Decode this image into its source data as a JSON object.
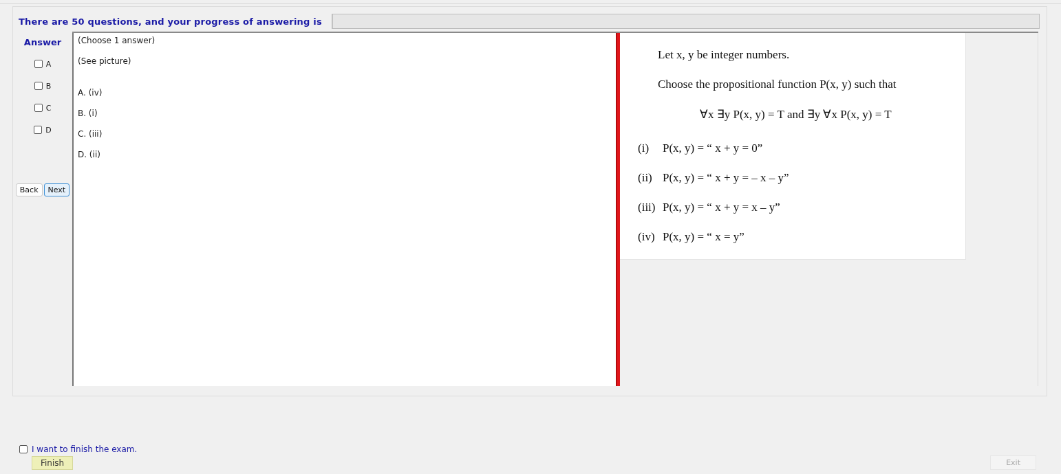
{
  "header": {
    "text": "There are 50 questions, and your progress of answering is",
    "progress": {
      "level": 0
    }
  },
  "answer": {
    "title": "Answer",
    "options": [
      {
        "label": "A",
        "checked": false
      },
      {
        "label": "B",
        "checked": false
      },
      {
        "label": "C",
        "checked": false
      },
      {
        "label": "D",
        "checked": false
      }
    ]
  },
  "nav_buttons": [
    {
      "label": "Back",
      "focused": false
    },
    {
      "label": "Next",
      "focused": true
    }
  ],
  "question_text": {
    "notes": [
      "(Choose 1 answer)",
      "(See picture)"
    ],
    "choices": [
      "A.  (iv)",
      "B.  (i)",
      "C.  (iii)",
      "D.  (ii)"
    ]
  },
  "question_image": {
    "intro": [
      "Let x, y be integer numbers.",
      "Choose the propositional function P(x, y) such that"
    ],
    "formula": "∀x ∃y P(x, y) = T and ∃y ∀x P(x, y) = T",
    "items": [
      {
        "num": "(i)",
        "text": "P(x, y) = “ x + y = 0”"
      },
      {
        "num": "(ii)",
        "text": "P(x, y) = “ x + y = – x – y”"
      },
      {
        "num": "(iii)",
        "text": "P(x, y) = “ x + y = x – y”"
      },
      {
        "num": "(iv)",
        "text": "P(x, y) = “ x = y”"
      }
    ]
  },
  "finish": {
    "label": "I want to finish the exam.",
    "checked": false,
    "button": "Finish"
  },
  "exit_button": {
    "label": "Exit",
    "disabled": true
  }
}
